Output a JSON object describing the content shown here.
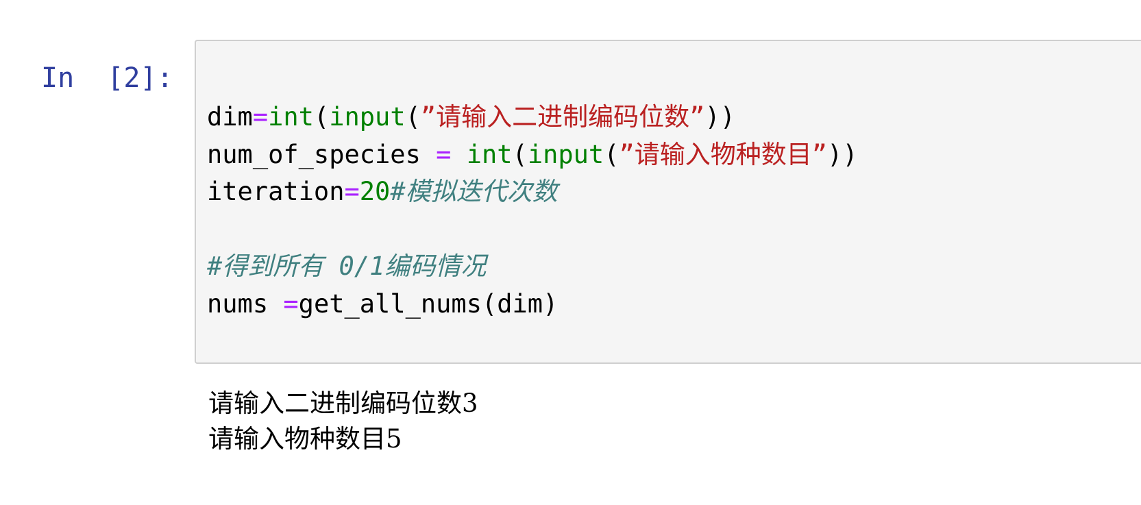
{
  "cell": {
    "prompt": "In  [2]:",
    "code": {
      "line1": {
        "var": "dim",
        "op": "=",
        "func": "int",
        "p1": "(",
        "func2": "input",
        "p2": "(",
        "str": "”请输入二进制编码位数”",
        "p3": "))"
      },
      "line2": {
        "var": "num_of_species ",
        "op": "=",
        "sp": " ",
        "func": "int",
        "p1": "(",
        "func2": "input",
        "p2": "(",
        "str": "”请输入物种数目”",
        "p3": "))"
      },
      "line3": {
        "var": "iteration",
        "op": "=",
        "num": "20",
        "comment": "#模拟迭代次数"
      },
      "line5": {
        "comment": "#得到所有 0/1编码情况"
      },
      "line6": {
        "var": "nums ",
        "op": "=",
        "rest": "get_all_nums(dim)"
      }
    },
    "output_lines": [
      "请输入二进制编码位数3",
      "请输入物种数目5"
    ]
  },
  "colors": {
    "prompt": "#303f9f",
    "operator": "#aa22ff",
    "builtin": "#008000",
    "string": "#ba2121",
    "number": "#008000",
    "comment": "#408080",
    "cell_background": "#f5f5f5",
    "cell_border": "#cfcfcf"
  }
}
